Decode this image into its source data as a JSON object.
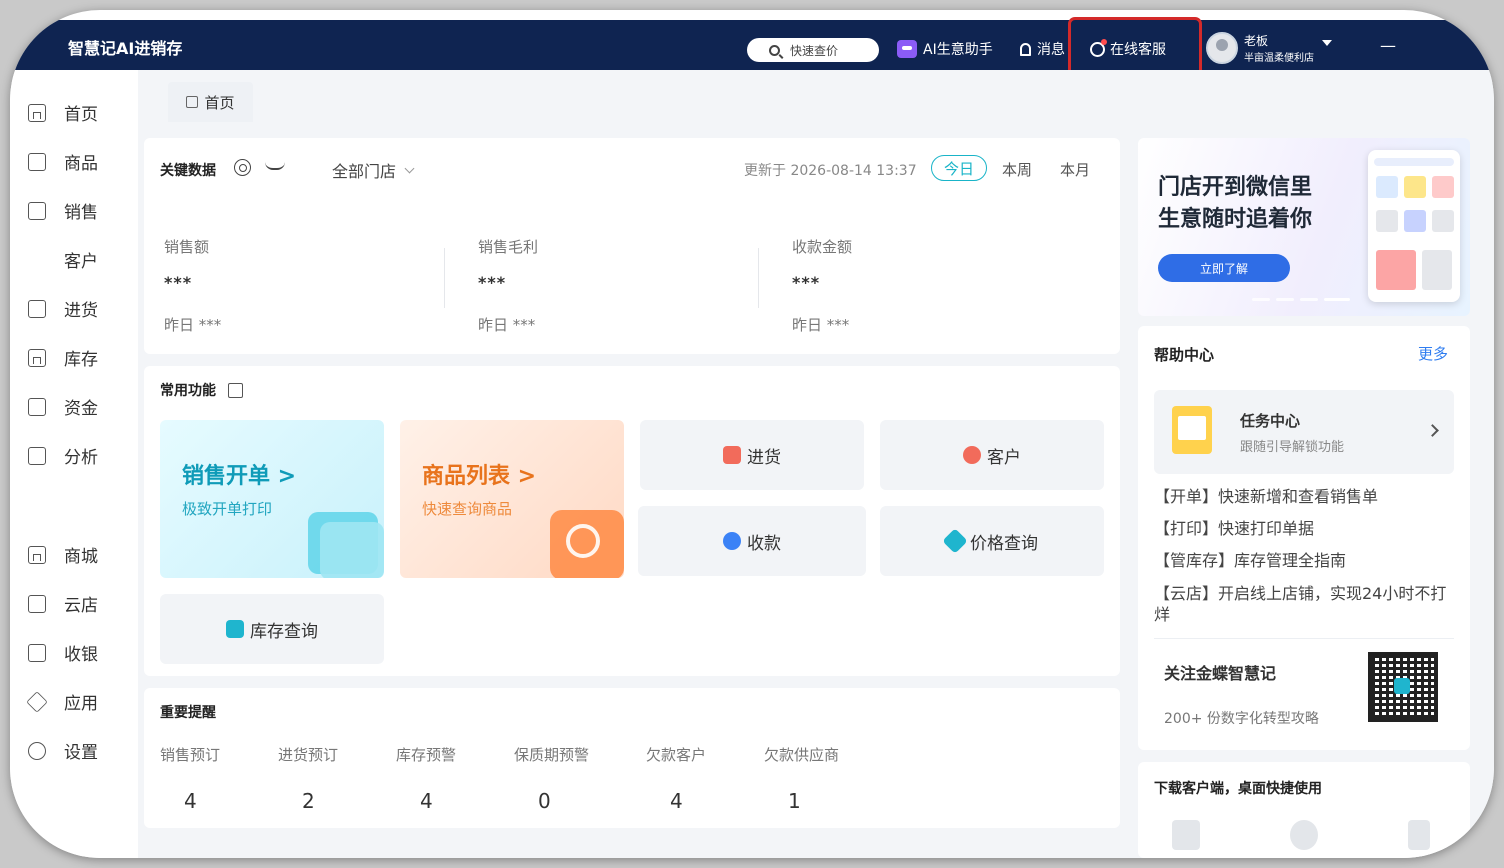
{
  "app": {
    "title": "智慧记AI进销存"
  },
  "topbar": {
    "search_label": "快速查价",
    "ai_label": "AI生意助手",
    "message_label": "消息",
    "service_label": "在线客服",
    "user_role": "老板",
    "user_store": "半亩温柔便利店",
    "minimize": "—"
  },
  "sidebar": {
    "items": [
      {
        "label": "首页",
        "icon": "home-icon"
      },
      {
        "label": "商品",
        "icon": "goods-icon"
      },
      {
        "label": "销售",
        "icon": "sales-icon"
      },
      {
        "label": "客户",
        "icon": "user-icon"
      },
      {
        "label": "进货",
        "icon": "purchase-icon"
      },
      {
        "label": "库存",
        "icon": "warehouse-icon"
      },
      {
        "label": "资金",
        "icon": "wallet-icon"
      },
      {
        "label": "分析",
        "icon": "chart-icon"
      },
      {
        "label": "商城",
        "icon": "mall-icon"
      },
      {
        "label": "云店",
        "icon": "cloud-store-icon"
      },
      {
        "label": "收银",
        "icon": "cashier-icon"
      },
      {
        "label": "应用",
        "icon": "apps-icon"
      },
      {
        "label": "设置",
        "icon": "gear-icon"
      }
    ]
  },
  "tabs": {
    "home": "首页"
  },
  "key_data": {
    "title": "关键数据",
    "store_select": "全部门店",
    "updated": "更新于 2026-08-14 13:37",
    "periods": [
      "今日",
      "本周",
      "本月"
    ],
    "active_period": "今日",
    "metrics": [
      {
        "label": "销售额",
        "value": "***",
        "yesterday": "昨日 ***"
      },
      {
        "label": "销售毛利",
        "value": "***",
        "yesterday": "昨日 ***"
      },
      {
        "label": "收款金额",
        "value": "***",
        "yesterday": "昨日 ***"
      }
    ]
  },
  "common": {
    "title": "常用功能",
    "sales_title": "销售开单 >",
    "sales_sub": "极致开单打印",
    "goods_title": "商品列表 >",
    "goods_sub": "快速查询商品",
    "purchase": "进货",
    "customer": "客户",
    "receipt": "收款",
    "price_query": "价格查询",
    "stock_query": "库存查询"
  },
  "reminders": {
    "title": "重要提醒",
    "items": [
      {
        "label": "销售预订",
        "count": "4"
      },
      {
        "label": "进货预订",
        "count": "2"
      },
      {
        "label": "库存预警",
        "count": "4"
      },
      {
        "label": "保质期预警",
        "count": "0"
      },
      {
        "label": "欠款客户",
        "count": "4"
      },
      {
        "label": "欠款供应商",
        "count": "1"
      }
    ]
  },
  "banner": {
    "line1": "门店开到微信里",
    "line2": "生意随时追着你",
    "button": "立即了解"
  },
  "help": {
    "title": "帮助中心",
    "more": "更多",
    "task_name": "任务中心",
    "task_sub": "跟随引导解锁功能",
    "links": [
      "【开单】快速新增和查看销售单",
      "【打印】快速打印单据",
      "【管库存】库存管理全指南",
      "【云店】开启线上店铺，实现24小时不打烊"
    ],
    "follow_title": "关注金蝶智慧记",
    "follow_sub": "200+ 份数字化转型攻略"
  },
  "download": {
    "title": "下载客户端，桌面快捷使用",
    "icons": [
      "windows-icon",
      "apple-icon",
      "tablet-icon"
    ]
  },
  "colors": {
    "topbar": "#0f2451",
    "accent": "#19b4c8",
    "highlight": "#d42a2a"
  }
}
